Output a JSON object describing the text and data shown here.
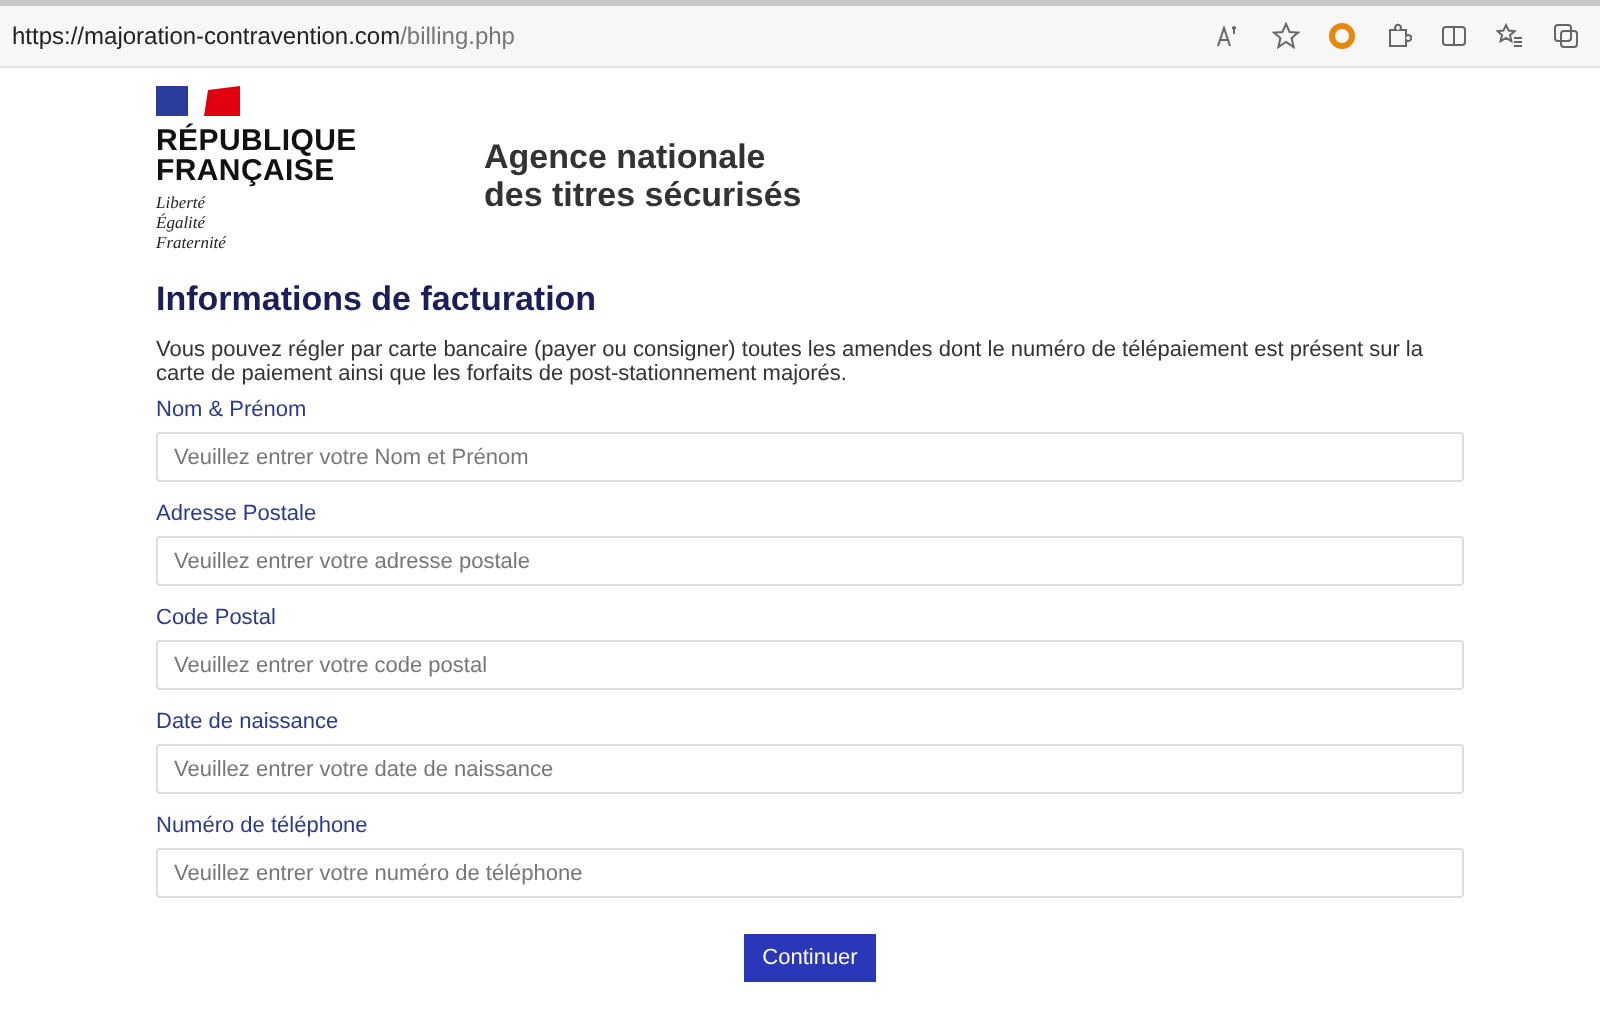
{
  "browser": {
    "url_host": "https://majoration-contravention.com",
    "url_path": "/billing.php"
  },
  "header": {
    "logo_lines": [
      "RÉPUBLIQUE",
      "FRANÇAISE"
    ],
    "motto": [
      "Liberté",
      "Égalité",
      "Fraternité"
    ],
    "agency": [
      "Agence nationale",
      "des titres sécurisés"
    ]
  },
  "form": {
    "title": "Informations de facturation",
    "intro": "Vous pouvez régler par carte bancaire (payer ou consigner) toutes les amendes dont le numéro de télépaiement est présent sur la carte de paiement ainsi que les forfaits de post-stationnement majorés.",
    "fields": [
      {
        "label": "Nom & Prénom",
        "placeholder": "Veuillez entrer votre Nom et Prénom"
      },
      {
        "label": "Adresse Postale",
        "placeholder": "Veuillez entrer votre adresse postale"
      },
      {
        "label": "Code Postal",
        "placeholder": "Veuillez entrer votre code postal"
      },
      {
        "label": "Date de naissance",
        "placeholder": "Veuillez entrer votre date de naissance"
      },
      {
        "label": "Numéro de téléphone",
        "placeholder": "Veuillez entrer votre numéro de téléphone"
      }
    ],
    "submit": "Continuer"
  }
}
